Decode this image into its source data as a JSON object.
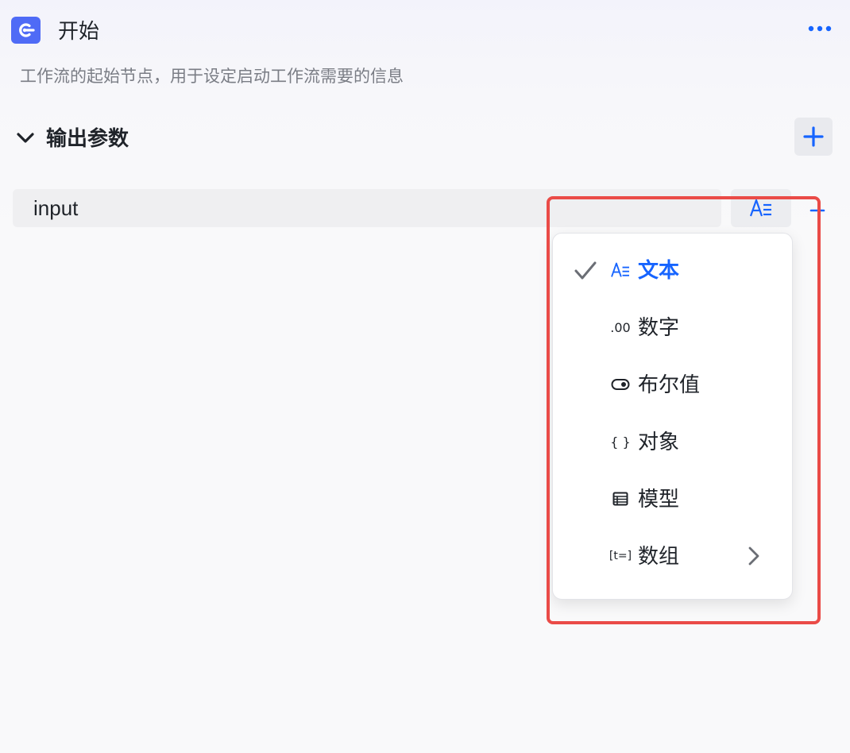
{
  "header": {
    "title": "开始",
    "logo_icon": "node-start-icon",
    "more_icon": "more-dots-icon"
  },
  "description": "工作流的起始节点，用于设定启动工作流需要的信息",
  "output_section": {
    "title": "输出参数",
    "collapse_icon": "chevron-down-icon",
    "add_icon": "plus-icon",
    "params": [
      {
        "name": "input",
        "type_icon": "text-type-icon",
        "remove_icon": "minus-icon"
      }
    ]
  },
  "type_menu": {
    "items": [
      {
        "label": "文本",
        "icon": "text-type-icon",
        "icon_text": "A≡",
        "selected": true
      },
      {
        "label": "数字",
        "icon": "number-type-icon",
        "icon_text": ".00",
        "selected": false
      },
      {
        "label": "布尔值",
        "icon": "toggle-icon",
        "icon_text": "",
        "selected": false
      },
      {
        "label": "对象",
        "icon": "braces-icon",
        "icon_text": "{ }",
        "selected": false
      },
      {
        "label": "模型",
        "icon": "table-icon",
        "icon_text": "",
        "selected": false
      },
      {
        "label": "数组",
        "icon": "array-icon",
        "icon_text": "[t=]",
        "selected": false,
        "has_submenu": true
      }
    ]
  },
  "colors": {
    "accent": "#1664ff",
    "logo_bg": "#4f6bf6",
    "highlight": "#ea4b47"
  }
}
